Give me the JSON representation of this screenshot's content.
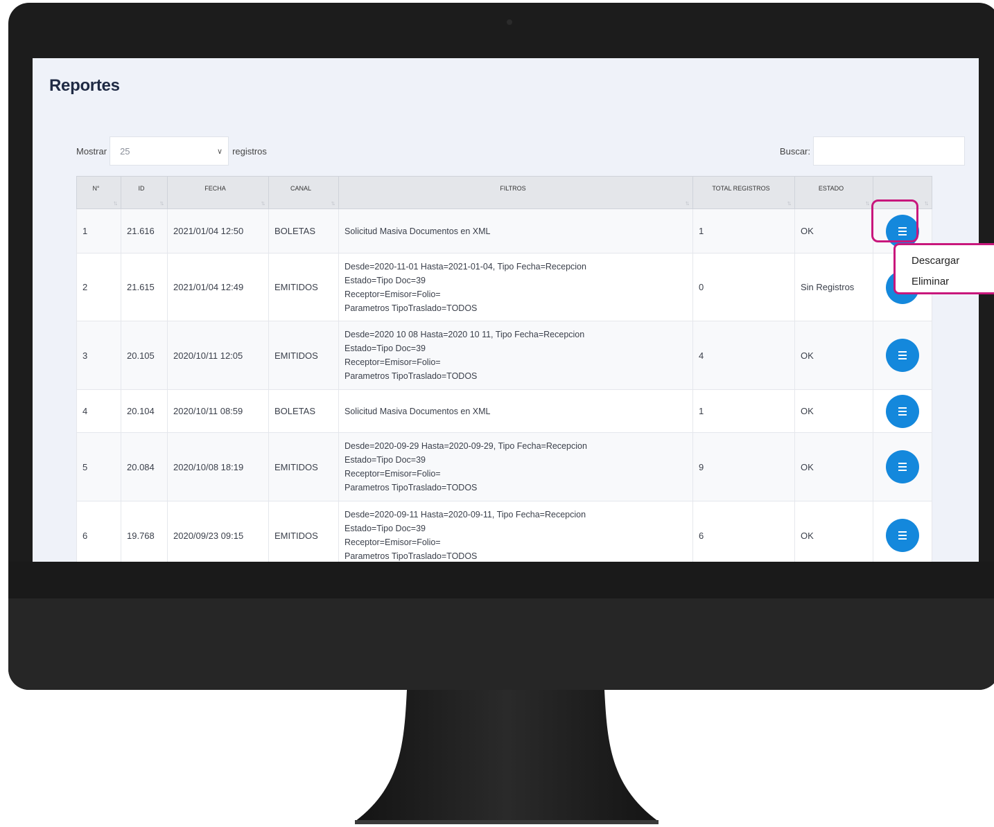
{
  "page": {
    "title": "Reportes"
  },
  "controls": {
    "show_label": "Mostrar",
    "page_size": "25",
    "records_label": "registros",
    "search_label": "Buscar:",
    "search_value": ""
  },
  "table": {
    "columns": [
      "N°",
      "ID",
      "FECHA",
      "CANAL",
      "FILTROS",
      "TOTAL REGISTROS",
      "ESTADO",
      ""
    ],
    "rows": [
      {
        "n": "1",
        "id": "21.616",
        "fecha": "2021/01/04 12:50",
        "canal": "BOLETAS",
        "filtros": [
          "Solicitud Masiva Documentos en XML"
        ],
        "total": "1",
        "estado": "OK"
      },
      {
        "n": "2",
        "id": "21.615",
        "fecha": "2021/01/04 12:49",
        "canal": "EMITIDOS",
        "filtros": [
          "Desde=2020-11-01 Hasta=2021-01-04, Tipo Fecha=Recepcion",
          "Estado=Tipo Doc=39",
          "Receptor=Emisor=Folio=",
          "Parametros TipoTraslado=TODOS"
        ],
        "total": "0",
        "estado": "Sin Registros"
      },
      {
        "n": "3",
        "id": "20.105",
        "fecha": "2020/10/11 12:05",
        "canal": "EMITIDOS",
        "filtros": [
          "Desde=2020 10 08 Hasta=2020 10 11, Tipo Fecha=Recepcion",
          "Estado=Tipo Doc=39",
          "Receptor=Emisor=Folio=",
          "Parametros TipoTraslado=TODOS"
        ],
        "total": "4",
        "estado": "OK"
      },
      {
        "n": "4",
        "id": "20.104",
        "fecha": "2020/10/11 08:59",
        "canal": "BOLETAS",
        "filtros": [
          "Solicitud Masiva Documentos en XML"
        ],
        "total": "1",
        "estado": "OK"
      },
      {
        "n": "5",
        "id": "20.084",
        "fecha": "2020/10/08 18:19",
        "canal": "EMITIDOS",
        "filtros": [
          "Desde=2020-09-29 Hasta=2020-09-29, Tipo Fecha=Recepcion",
          "Estado=Tipo Doc=39",
          "Receptor=Emisor=Folio=",
          "Parametros TipoTraslado=TODOS"
        ],
        "total": "9",
        "estado": "OK"
      },
      {
        "n": "6",
        "id": "19.768",
        "fecha": "2020/09/23 09:15",
        "canal": "EMITIDOS",
        "filtros": [
          "Desde=2020-09-11 Hasta=2020-09-11, Tipo Fecha=Recepcion",
          "Estado=Tipo Doc=39",
          "Receptor=Emisor=Folio=",
          "Parametros TipoTraslado=TODOS"
        ],
        "total": "6",
        "estado": "OK"
      }
    ]
  },
  "row_menu": {
    "items": [
      "Descargar",
      "Eliminar"
    ]
  },
  "colors": {
    "accent": "#1488dc",
    "highlight": "#c8177c"
  },
  "icons": {
    "row_action": "hamburger-menu-icon"
  }
}
